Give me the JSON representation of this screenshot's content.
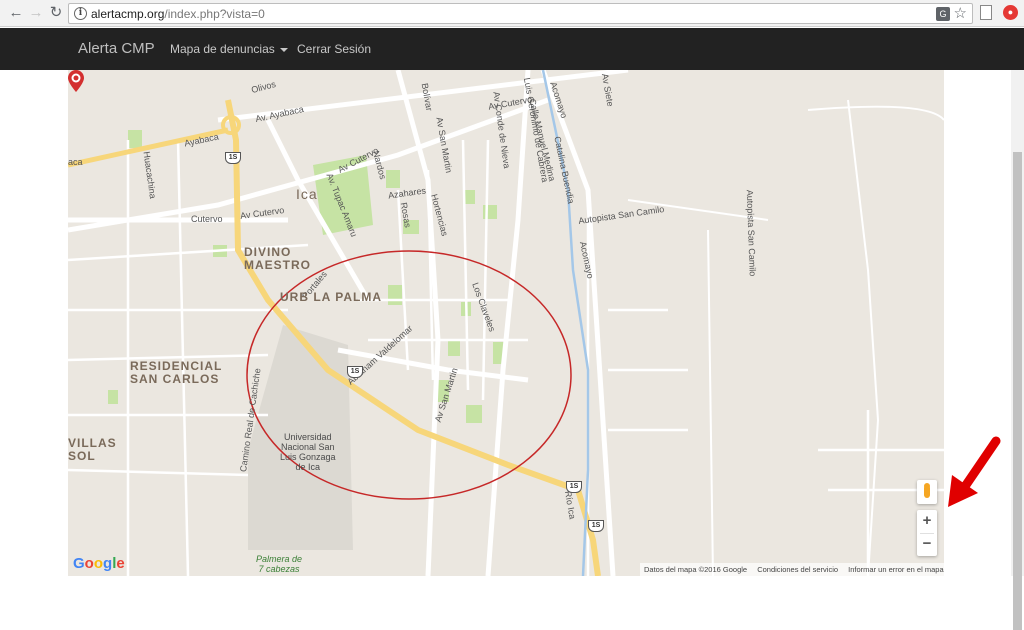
{
  "browser": {
    "url_host": "alertacmp.org",
    "url_path": "/index.php?vista=0",
    "back_icon": "arrow-left-icon",
    "forward_icon": "arrow-right-icon",
    "reload_icon": "reload-icon"
  },
  "navbar": {
    "brand": "Alerta CMP",
    "menu_denuncias": "Mapa de denuncias",
    "logout": "Cerrar Sesión"
  },
  "map": {
    "streets": {
      "ayacaba_top": "Av. Ayabaca",
      "ayabaca_left": "Ayabaca",
      "olivos": "Olivos",
      "cutervo_top": "Av Cutervo",
      "cutervo_mid": "Av Cutervo",
      "cutervo_lower": "Av Cutervo",
      "cutervo_left": "Cutervo",
      "ica": "Ica",
      "huacachina": "Huacachina",
      "aca": "aca",
      "nardos": "Nardos",
      "azahares": "Azahares",
      "rosas": "Rosas",
      "hortencias": "Hortencias",
      "bolivar": "Bolívar",
      "san_martin_top": "Av San Martin",
      "san_martin_low": "Av San Martin",
      "conde_nieva": "Av Conde de Nieva",
      "luis_geronimo": "Luis Geronimo de Cabrera",
      "manuel_medina": "Calle Manuel Medina",
      "catalina": "Catalina Buendia",
      "acomayo_top": "Acomayo",
      "acomayo_mid": "Acomayo",
      "av_siete": "Av Siete",
      "autopista1": "Autopista San Camilo",
      "autopista2": "Autopista San Camilo",
      "tupac": "Av. Tupac Amaru",
      "portales": "Portales",
      "abraham": "Abraham Valdelomar",
      "claveles": "Los Claveles",
      "camino_real": "Camino Real de Cachiche",
      "rio_ica": "Río Ica"
    },
    "districts": {
      "divino_line1": "DIVINO",
      "divino_line2": "MAESTRO",
      "palma": "URB LA PALMA",
      "residencial_line1": "RESIDENCIAL",
      "residencial_line2": "SAN CARLOS",
      "villas_line1": "VILLAS",
      "villas_line2": "SOL"
    },
    "places": {
      "uni_line1": "Universidad",
      "uni_line2": "Nacional San",
      "uni_line3": "Luis Gonzaga",
      "uni_line4": "de Ica",
      "palmera_line1": "Palmera de",
      "palmera_line2": "7 cabezas"
    },
    "route_shield": "1S",
    "footer": {
      "data": "Datos del mapa ©2016 Google",
      "terms": "Condiciones del servicio",
      "report": "Informar un error en el mapa"
    },
    "logo": [
      "G",
      "o",
      "o",
      "g",
      "l",
      "e"
    ],
    "zoom_in": "+",
    "zoom_out": "−",
    "colors": {
      "land": "#ebe7e0",
      "road": "#ffffff",
      "highway": "#f7d67a",
      "park": "#c6e3a4",
      "river": "#a4c7e8",
      "circle": "#c62828",
      "arrow": "#e00000"
    }
  }
}
